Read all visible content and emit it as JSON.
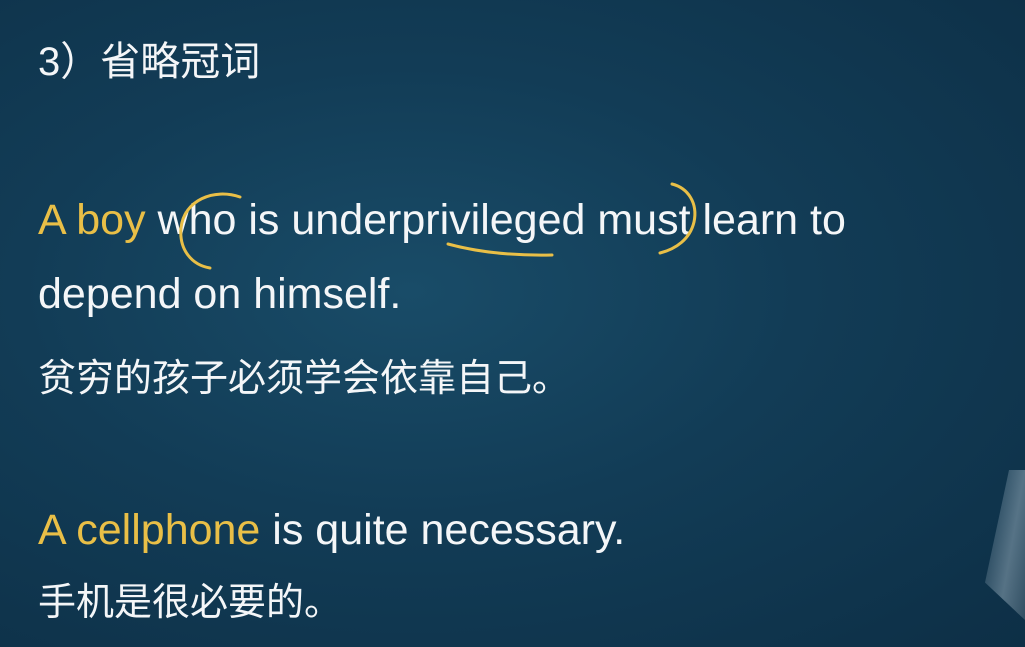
{
  "slide": {
    "heading": "3）省略冠词",
    "example1": {
      "en_highlight": "A boy",
      "en_rest_line1": " who is underprivileged must learn to",
      "en_line2": "depend on himself.",
      "zh": "贫穷的孩子必须学会依靠自己。"
    },
    "example2": {
      "en_highlight": "A cellphone",
      "en_rest": " is quite necessary.",
      "zh": "手机是很必要的。"
    },
    "colors": {
      "background": "#123c56",
      "text": "#f4f6f8",
      "highlight": "#e9bf47",
      "annotation": "#e9bf47"
    }
  }
}
